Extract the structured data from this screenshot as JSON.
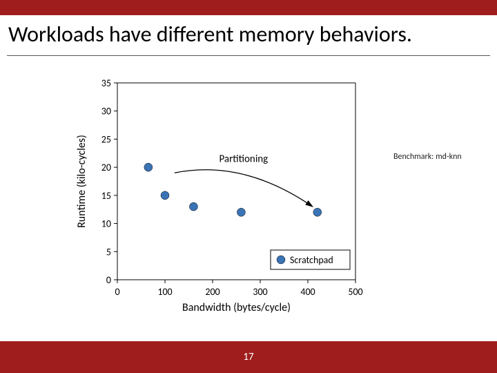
{
  "slide": {
    "title": "Workloads have different memory behaviors.",
    "page_number": "17",
    "benchmark_note": "Benchmark: md-knn"
  },
  "chart_data": {
    "type": "scatter",
    "xlabel": "Bandwidth (bytes/cycle)",
    "ylabel": "Runtime (kilo-cycles)",
    "xlim": [
      0,
      500
    ],
    "ylim": [
      0,
      35
    ],
    "x_ticks": [
      0,
      100,
      200,
      300,
      400,
      500
    ],
    "y_ticks": [
      0,
      5,
      10,
      15,
      20,
      25,
      30,
      35
    ],
    "series": [
      {
        "name": "Scratchpad",
        "color": "#3a74b6",
        "points": [
          {
            "x": 65,
            "y": 20
          },
          {
            "x": 100,
            "y": 15
          },
          {
            "x": 160,
            "y": 13
          },
          {
            "x": 260,
            "y": 12
          },
          {
            "x": 420,
            "y": 12
          }
        ]
      }
    ],
    "legend": {
      "label": "Scratchpad",
      "position": "lower-right"
    },
    "annotations": [
      {
        "text": "Partitioning",
        "type": "arrow-right",
        "from_x": 120,
        "from_y": 19,
        "to_x": 410,
        "to_y": 13
      }
    ]
  }
}
